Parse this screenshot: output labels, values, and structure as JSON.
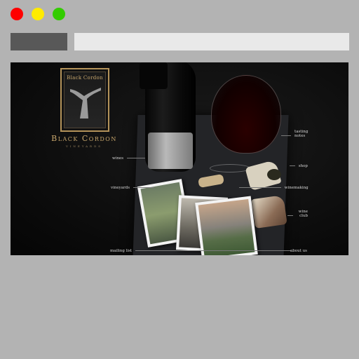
{
  "window": {
    "controls": [
      "close",
      "minimize",
      "maximize"
    ],
    "colors": {
      "close": "#ff0000",
      "minimize": "#ffeb00",
      "maximize": "#33cc00"
    }
  },
  "logo": {
    "badge_text": "Black Cordon",
    "name": "Black Cordon",
    "subtitle": "VINEYARDS"
  },
  "nav": {
    "wines": "wines",
    "vineyards": "vineyards",
    "mailing_list": "mailing list",
    "tasting_notes": "tasting notes",
    "shop": "shop",
    "winemaking": "winemaking",
    "wine_club": "wine club",
    "about_us": "about us"
  }
}
